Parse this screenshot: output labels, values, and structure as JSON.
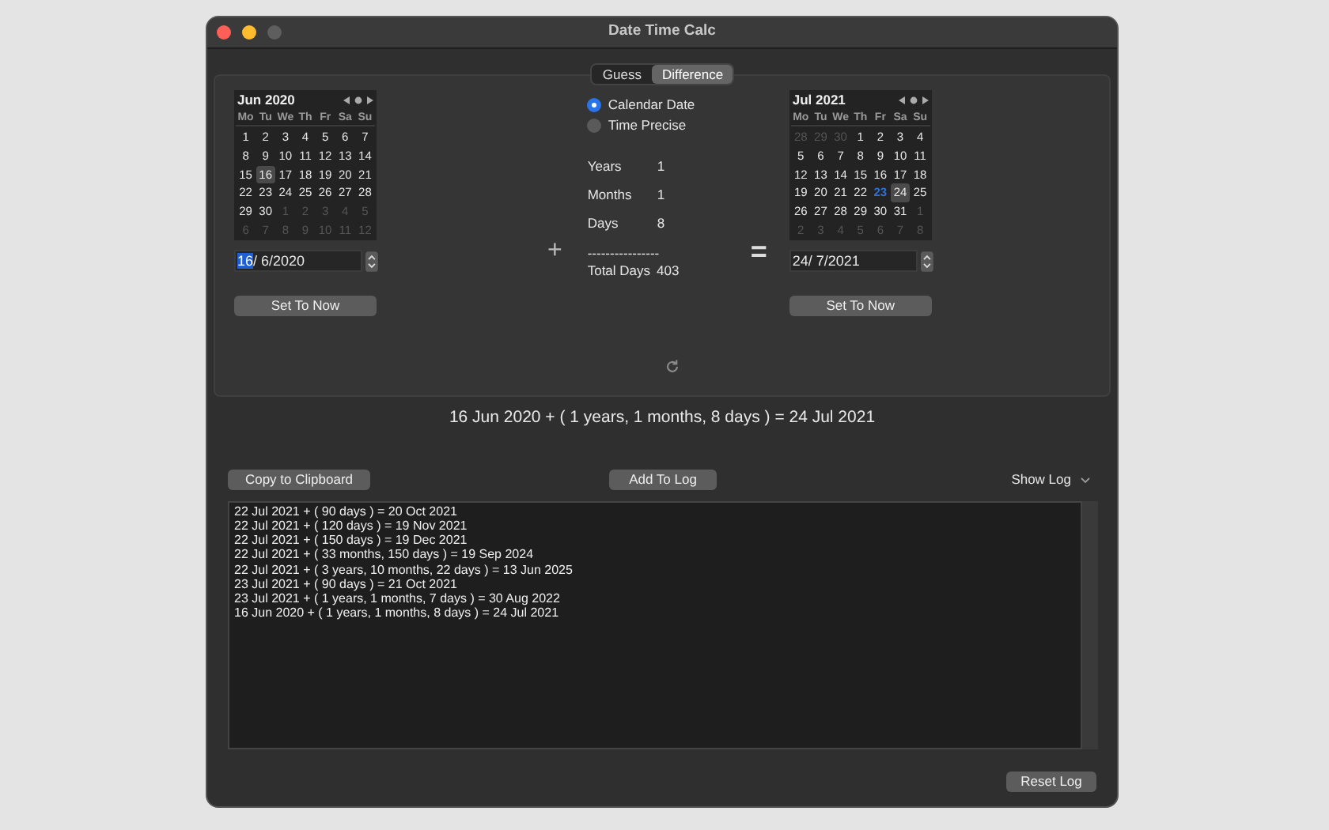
{
  "window": {
    "title": "Date Time Calc"
  },
  "tabs": [
    {
      "label": "Guess",
      "selected": false
    },
    {
      "label": "Difference",
      "selected": true
    }
  ],
  "start": {
    "calendar": {
      "title": "Jun 2020",
      "weekdays": [
        "Mo",
        "Tu",
        "We",
        "Th",
        "Fr",
        "Sa",
        "Su"
      ],
      "weeks": [
        [
          {
            "day": "1",
            "other_month": false,
            "selected": false,
            "today": false
          },
          {
            "day": "2",
            "other_month": false,
            "selected": false,
            "today": false
          },
          {
            "day": "3",
            "other_month": false,
            "selected": false,
            "today": false
          },
          {
            "day": "4",
            "other_month": false,
            "selected": false,
            "today": false
          },
          {
            "day": "5",
            "other_month": false,
            "selected": false,
            "today": false
          },
          {
            "day": "6",
            "other_month": false,
            "selected": false,
            "today": false
          },
          {
            "day": "7",
            "other_month": false,
            "selected": false,
            "today": false
          }
        ],
        [
          {
            "day": "8",
            "other_month": false,
            "selected": false,
            "today": false
          },
          {
            "day": "9",
            "other_month": false,
            "selected": false,
            "today": false
          },
          {
            "day": "10",
            "other_month": false,
            "selected": false,
            "today": false
          },
          {
            "day": "11",
            "other_month": false,
            "selected": false,
            "today": false
          },
          {
            "day": "12",
            "other_month": false,
            "selected": false,
            "today": false
          },
          {
            "day": "13",
            "other_month": false,
            "selected": false,
            "today": false
          },
          {
            "day": "14",
            "other_month": false,
            "selected": false,
            "today": false
          }
        ],
        [
          {
            "day": "15",
            "other_month": false,
            "selected": false,
            "today": false
          },
          {
            "day": "16",
            "other_month": false,
            "selected": true,
            "today": false
          },
          {
            "day": "17",
            "other_month": false,
            "selected": false,
            "today": false
          },
          {
            "day": "18",
            "other_month": false,
            "selected": false,
            "today": false
          },
          {
            "day": "19",
            "other_month": false,
            "selected": false,
            "today": false
          },
          {
            "day": "20",
            "other_month": false,
            "selected": false,
            "today": false
          },
          {
            "day": "21",
            "other_month": false,
            "selected": false,
            "today": false
          }
        ],
        [
          {
            "day": "22",
            "other_month": false,
            "selected": false,
            "today": false
          },
          {
            "day": "23",
            "other_month": false,
            "selected": false,
            "today": false
          },
          {
            "day": "24",
            "other_month": false,
            "selected": false,
            "today": false
          },
          {
            "day": "25",
            "other_month": false,
            "selected": false,
            "today": false
          },
          {
            "day": "26",
            "other_month": false,
            "selected": false,
            "today": false
          },
          {
            "day": "27",
            "other_month": false,
            "selected": false,
            "today": false
          },
          {
            "day": "28",
            "other_month": false,
            "selected": false,
            "today": false
          }
        ],
        [
          {
            "day": "29",
            "other_month": false,
            "selected": false,
            "today": false
          },
          {
            "day": "30",
            "other_month": false,
            "selected": false,
            "today": false
          },
          {
            "day": "1",
            "other_month": true,
            "selected": false,
            "today": false
          },
          {
            "day": "2",
            "other_month": true,
            "selected": false,
            "today": false
          },
          {
            "day": "3",
            "other_month": true,
            "selected": false,
            "today": false
          },
          {
            "day": "4",
            "other_month": true,
            "selected": false,
            "today": false
          },
          {
            "day": "5",
            "other_month": true,
            "selected": false,
            "today": false
          }
        ],
        [
          {
            "day": "6",
            "other_month": true,
            "selected": false,
            "today": false
          },
          {
            "day": "7",
            "other_month": true,
            "selected": false,
            "today": false
          },
          {
            "day": "8",
            "other_month": true,
            "selected": false,
            "today": false
          },
          {
            "day": "9",
            "other_month": true,
            "selected": false,
            "today": false
          },
          {
            "day": "10",
            "other_month": true,
            "selected": false,
            "today": false
          },
          {
            "day": "11",
            "other_month": true,
            "selected": false,
            "today": false
          },
          {
            "day": "12",
            "other_month": true,
            "selected": false,
            "today": false
          }
        ]
      ]
    },
    "date_field": {
      "segments": [
        {
          "text": "16",
          "selected": true
        },
        {
          "text": "/ 6/2020",
          "selected": false
        }
      ]
    },
    "button": "Set To Now"
  },
  "operator": "+",
  "mode_options": [
    {
      "label": "Calendar Date",
      "selected": true
    },
    {
      "label": "Time Precise",
      "selected": false
    }
  ],
  "difference": [
    {
      "label": "Years",
      "value": "1"
    },
    {
      "label": "Months",
      "value": "1"
    },
    {
      "label": "Days",
      "value": "8"
    }
  ],
  "separator": "----------------",
  "total": {
    "label": "Total Days",
    "value": "403"
  },
  "equals": "=",
  "end": {
    "calendar": {
      "title": "Jul 2021",
      "weekdays": [
        "Mo",
        "Tu",
        "We",
        "Th",
        "Fr",
        "Sa",
        "Su"
      ],
      "weeks": [
        [
          {
            "day": "28",
            "other_month": true,
            "selected": false,
            "today": false
          },
          {
            "day": "29",
            "other_month": true,
            "selected": false,
            "today": false
          },
          {
            "day": "30",
            "other_month": true,
            "selected": false,
            "today": false
          },
          {
            "day": "1",
            "other_month": false,
            "selected": false,
            "today": false
          },
          {
            "day": "2",
            "other_month": false,
            "selected": false,
            "today": false
          },
          {
            "day": "3",
            "other_month": false,
            "selected": false,
            "today": false
          },
          {
            "day": "4",
            "other_month": false,
            "selected": false,
            "today": false
          }
        ],
        [
          {
            "day": "5",
            "other_month": false,
            "selected": false,
            "today": false
          },
          {
            "day": "6",
            "other_month": false,
            "selected": false,
            "today": false
          },
          {
            "day": "7",
            "other_month": false,
            "selected": false,
            "today": false
          },
          {
            "day": "8",
            "other_month": false,
            "selected": false,
            "today": false
          },
          {
            "day": "9",
            "other_month": false,
            "selected": false,
            "today": false
          },
          {
            "day": "10",
            "other_month": false,
            "selected": false,
            "today": false
          },
          {
            "day": "11",
            "other_month": false,
            "selected": false,
            "today": false
          }
        ],
        [
          {
            "day": "12",
            "other_month": false,
            "selected": false,
            "today": false
          },
          {
            "day": "13",
            "other_month": false,
            "selected": false,
            "today": false
          },
          {
            "day": "14",
            "other_month": false,
            "selected": false,
            "today": false
          },
          {
            "day": "15",
            "other_month": false,
            "selected": false,
            "today": false
          },
          {
            "day": "16",
            "other_month": false,
            "selected": false,
            "today": false
          },
          {
            "day": "17",
            "other_month": false,
            "selected": false,
            "today": false
          },
          {
            "day": "18",
            "other_month": false,
            "selected": false,
            "today": false
          }
        ],
        [
          {
            "day": "19",
            "other_month": false,
            "selected": false,
            "today": false
          },
          {
            "day": "20",
            "other_month": false,
            "selected": false,
            "today": false
          },
          {
            "day": "21",
            "other_month": false,
            "selected": false,
            "today": false
          },
          {
            "day": "22",
            "other_month": false,
            "selected": false,
            "today": false
          },
          {
            "day": "23",
            "other_month": false,
            "selected": false,
            "today": true
          },
          {
            "day": "24",
            "other_month": false,
            "selected": true,
            "today": false
          },
          {
            "day": "25",
            "other_month": false,
            "selected": false,
            "today": false
          }
        ],
        [
          {
            "day": "26",
            "other_month": false,
            "selected": false,
            "today": false
          },
          {
            "day": "27",
            "other_month": false,
            "selected": false,
            "today": false
          },
          {
            "day": "28",
            "other_month": false,
            "selected": false,
            "today": false
          },
          {
            "day": "29",
            "other_month": false,
            "selected": false,
            "today": false
          },
          {
            "day": "30",
            "other_month": false,
            "selected": false,
            "today": false
          },
          {
            "day": "31",
            "other_month": false,
            "selected": false,
            "today": false
          },
          {
            "day": "1",
            "other_month": true,
            "selected": false,
            "today": false
          }
        ],
        [
          {
            "day": "2",
            "other_month": true,
            "selected": false,
            "today": false
          },
          {
            "day": "3",
            "other_month": true,
            "selected": false,
            "today": false
          },
          {
            "day": "4",
            "other_month": true,
            "selected": false,
            "today": false
          },
          {
            "day": "5",
            "other_month": true,
            "selected": false,
            "today": false
          },
          {
            "day": "6",
            "other_month": true,
            "selected": false,
            "today": false
          },
          {
            "day": "7",
            "other_month": true,
            "selected": false,
            "today": false
          },
          {
            "day": "8",
            "other_month": true,
            "selected": false,
            "today": false
          }
        ]
      ]
    },
    "date_field": {
      "segments": [
        {
          "text": "24/ 7/2021",
          "selected": false
        }
      ]
    },
    "button": "Set To Now"
  },
  "summary": "16 Jun 2020 + ( 1 years, 1 months, 8 days ) = 24 Jul 2021",
  "actions": {
    "copy": "Copy to Clipboard",
    "add": "Add To Log",
    "show_log": "Show Log"
  },
  "log": [
    "22 Jul 2021 + ( 90 days ) = 20 Oct 2021",
    "22 Jul 2021 + ( 120 days ) = 19 Nov 2021",
    "22 Jul 2021 + ( 150 days ) = 19 Dec 2021",
    "22 Jul 2021 + ( 33 months, 150 days ) = 19 Sep 2024",
    "22 Jul 2021 + ( 3 years, 10 months, 22 days ) = 13 Jun 2025",
    "23 Jul 2021 + ( 90 days ) = 21 Oct 2021",
    "23 Jul 2021 + ( 1 years, 1 months, 7 days ) = 30 Aug 2022",
    "16 Jun 2020 + ( 1 years, 1 months, 8 days ) = 24 Jul 2021"
  ],
  "reset_button": "Reset Log"
}
